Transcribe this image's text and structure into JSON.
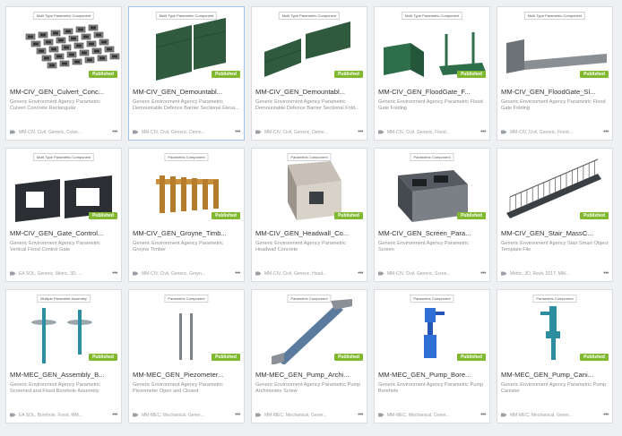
{
  "cards": [
    {
      "title": "MM-CIV_GEN_Culvert_Conc...",
      "caption": "Multi Type Parametric Component",
      "badge": "Published",
      "desc": "Generic Environment Agency Parametric Culvert Concrete Rectangular",
      "tags": "MM-CIV, Civil, Generic, Culve...",
      "art": "culvert"
    },
    {
      "title": "MM-CIV_GEN_Demountabl...",
      "caption": "Multi Type Parametric Component",
      "badge": "Published",
      "desc": "Generic Environment Agency Parametric Demountable Defence Barrier Sectional Eleva...",
      "tags": "MM-CIV, Civil, Generic, Demo...",
      "art": "barrier"
    },
    {
      "title": "MM-CIV_GEN_Demountabl...",
      "caption": "Multi Type Parametric Component",
      "badge": "Published",
      "desc": "Generic Environment Agency Parametric Demountable Defence Barrier Sectional Fold...",
      "tags": "MM-CIV, Civil, Generic, Demo...",
      "art": "barrier2"
    },
    {
      "title": "MM-CIV_GEN_FloodGate_F...",
      "caption": "Multi Type Parametric Component",
      "badge": "Published",
      "desc": "Generic Environment Agency Parametric Flood Gate Folding",
      "tags": "MM-CIV, Civil, Generic, Flood...",
      "art": "floodgate"
    },
    {
      "title": "MM-CIV_GEN_FloodGate_Sl...",
      "caption": "Multi Type Parametric Component",
      "badge": "Published",
      "desc": "Generic Environment Agency Parametric Flood Gate Folding",
      "tags": "MM-CIV, Civil, Generic, Flood...",
      "art": "floodgate2"
    },
    {
      "title": "MM-CIV_GEN_Gate_Control...",
      "caption": "Multi Type Parametric Component",
      "badge": "Published",
      "desc": "Generic Environment Agency Parametric Vertical Flood Control Gate",
      "tags": "EA SOL, Generic, Metric, 3D, ...",
      "art": "gate"
    },
    {
      "title": "MM-CIV_GEN_Groyne_Timb...",
      "caption": "Parametric Component",
      "badge": "Published",
      "desc": "Generic Environment Agency Parametric Groyne Timber",
      "tags": "MM-CIV, Civil, Generic, Groyn...",
      "art": "groyne"
    },
    {
      "title": "MM-CIV_GEN_Headwall_Co...",
      "caption": "Parametric Component",
      "badge": "Published",
      "desc": "Generic Environment Agency Parametric Headwall Concrete",
      "tags": "MM-CIV, Civil, Generic, Head...",
      "art": "headwall"
    },
    {
      "title": "MM-CIV_GEN_Screen_Para...",
      "caption": "Parametric Component",
      "badge": "Published",
      "desc": "Generic Environment Agency Parametric Screen",
      "tags": "MM-CIV, Civil, Generic, Scree...",
      "art": "screen"
    },
    {
      "title": "MM-CIV_GEN_Stair_MassC...",
      "caption": "",
      "badge": "Published",
      "desc": "Generic Environment Agency Stair Smart Object Template File",
      "tags": "Metric, 3D, Revit, 2017, MM...",
      "art": "stair"
    },
    {
      "title": "MM-MEC_GEN_Assembly_B...",
      "caption": "Multiple Parameter Assembly",
      "badge": "Published",
      "desc": "Generic Environment Agency Parametric Screened and Fixed Borehole Assembly",
      "tags": "EA SOL, Borehole, Fixed, MM...",
      "art": "assembly"
    },
    {
      "title": "MM-MEC_GEN_Piezometer...",
      "caption": "Parametric Component",
      "badge": "Published",
      "desc": "Generic Environment Agency Parametric Piezometer Open and Closed",
      "tags": "MM-MEC, Mechanical, Gener...",
      "art": "piezo"
    },
    {
      "title": "MM-MEC_GEN_Pump_Archi...",
      "caption": "Parametric Component",
      "badge": "Published",
      "desc": "Generic Environment Agency Parametric Pump Archimedes Screw",
      "tags": "MM-MEC, Mechanical, Gener...",
      "art": "archimedes"
    },
    {
      "title": "MM-MEC_GEN_Pump_Bore...",
      "caption": "Parametric Component",
      "badge": "Published",
      "desc": "Generic Environment Agency Parametric Pump Borehole",
      "tags": "MM-MEC, Mechanical, Gener...",
      "art": "borepump"
    },
    {
      "title": "MM-MEC_GEN_Pump_Cani...",
      "caption": "Parametric Component",
      "badge": "Published",
      "desc": "Generic Environment Agency Parametric Pump Canister",
      "tags": "MM-MEC, Mechanical, Gener...",
      "art": "canister"
    }
  ],
  "more_label": "•••",
  "colors": {
    "published": "#80b92f",
    "barrier": "#2f5a3e",
    "timber": "#c9913b",
    "steel": "#3a3f44",
    "pump_blue": "#2f6fd6",
    "pump_teal": "#2c8ea0"
  }
}
